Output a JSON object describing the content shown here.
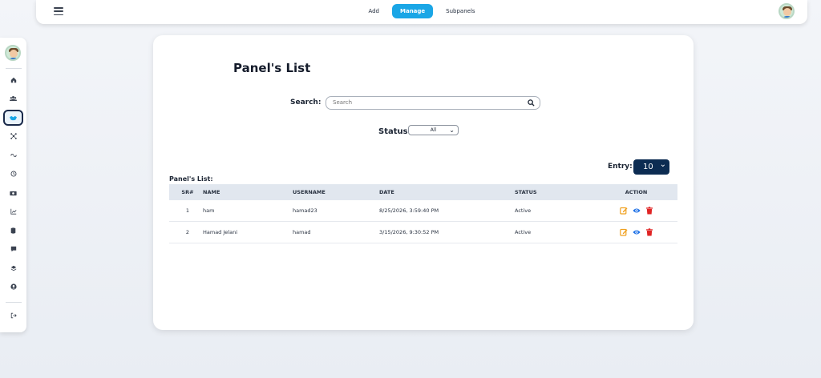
{
  "topnav": {
    "tabs": [
      {
        "label": "Add",
        "active": false
      },
      {
        "label": "Manage",
        "active": true
      },
      {
        "label": "Subpanels",
        "active": false
      }
    ]
  },
  "sidebar": {
    "items": [
      {
        "icon": "home-icon"
      },
      {
        "icon": "users-icon"
      },
      {
        "icon": "handshake-icon",
        "active": true
      },
      {
        "icon": "network-icon"
      },
      {
        "icon": "link-icon"
      },
      {
        "icon": "history-icon"
      },
      {
        "icon": "money-icon"
      },
      {
        "icon": "chart-icon"
      },
      {
        "icon": "database-icon"
      },
      {
        "icon": "chat-icon"
      },
      {
        "icon": "layers-icon"
      },
      {
        "icon": "user-circle-icon"
      },
      {
        "icon": "logout-icon"
      }
    ]
  },
  "card": {
    "title": "Panel's List",
    "search_label": "Search:",
    "search_placeholder": "Search",
    "status_label": "Status",
    "status_value": "All",
    "entry_label": "Entry:",
    "entry_value": "10",
    "list_caption": "Panel's List:"
  },
  "table": {
    "headers": {
      "sr": "SR#",
      "name": "NAME",
      "username": "USERNAME",
      "date": "DATE",
      "status": "STATUS",
      "action": "ACTION"
    },
    "rows": [
      {
        "sr": "1",
        "name": "ham",
        "username": "hamad23",
        "date": "8/25/2026, 3:59:40 PM",
        "status": "Active"
      },
      {
        "sr": "2",
        "name": "Hamad Jelani",
        "username": "hamad",
        "date": "3/15/2026, 9:30:52 PM",
        "status": "Active"
      }
    ]
  },
  "colors": {
    "accent": "#1aa6e6",
    "entry_bg": "#0c2c52",
    "edit": "#f0a01e",
    "view": "#1a6ee6",
    "delete": "#e02424"
  }
}
